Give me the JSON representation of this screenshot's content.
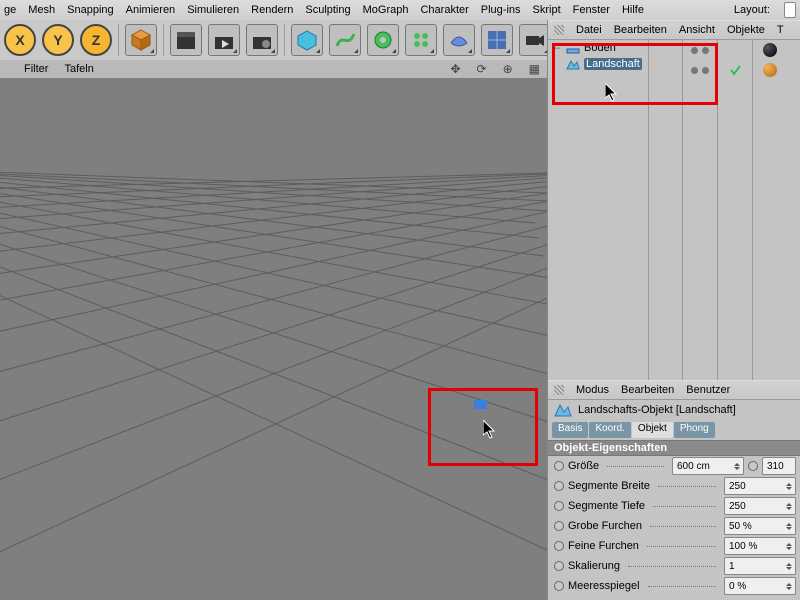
{
  "menubar": {
    "items": [
      "ge",
      "Mesh",
      "Snapping",
      "Animieren",
      "Simulieren",
      "Rendern",
      "Sculpting",
      "MoGraph",
      "Charakter",
      "Plug-ins",
      "Skript",
      "Fenster",
      "Hilfe"
    ],
    "layout_label": "Layout:"
  },
  "toolbar": {
    "axes": {
      "x": "X",
      "y": "Y",
      "z": "Z"
    }
  },
  "substrip": {
    "items": [
      "",
      "Filter",
      "Tafeln"
    ]
  },
  "object_manager": {
    "menu": [
      "Datei",
      "Bearbeiten",
      "Ansicht",
      "Objekte",
      "T"
    ],
    "rows": [
      {
        "label": "Boden",
        "selected": false,
        "icon": "floor",
        "tag": "dark"
      },
      {
        "label": "Landschaft",
        "selected": true,
        "icon": "landscape",
        "tag": "orange",
        "check": true
      }
    ]
  },
  "attribute_manager": {
    "menu": [
      "Modus",
      "Bearbeiten",
      "Benutzer"
    ],
    "title": "Landschafts-Objekt [Landschaft]",
    "tabs": [
      "Basis",
      "Koord.",
      "Objekt",
      "Phong"
    ],
    "active_tab": 2,
    "section": "Objekt-Eigenschaften",
    "props": [
      {
        "label": "Größe",
        "value": "600 cm",
        "extra": "310"
      },
      {
        "label": "Segmente Breite",
        "value": "250"
      },
      {
        "label": "Segmente Tiefe",
        "value": "250"
      },
      {
        "label": "Grobe Furchen",
        "value": "50 %"
      },
      {
        "label": "Feine Furchen",
        "value": "100 %"
      },
      {
        "label": "Skalierung",
        "value": "1"
      },
      {
        "label": "Meeresspiegel",
        "value": "0 %"
      }
    ]
  }
}
